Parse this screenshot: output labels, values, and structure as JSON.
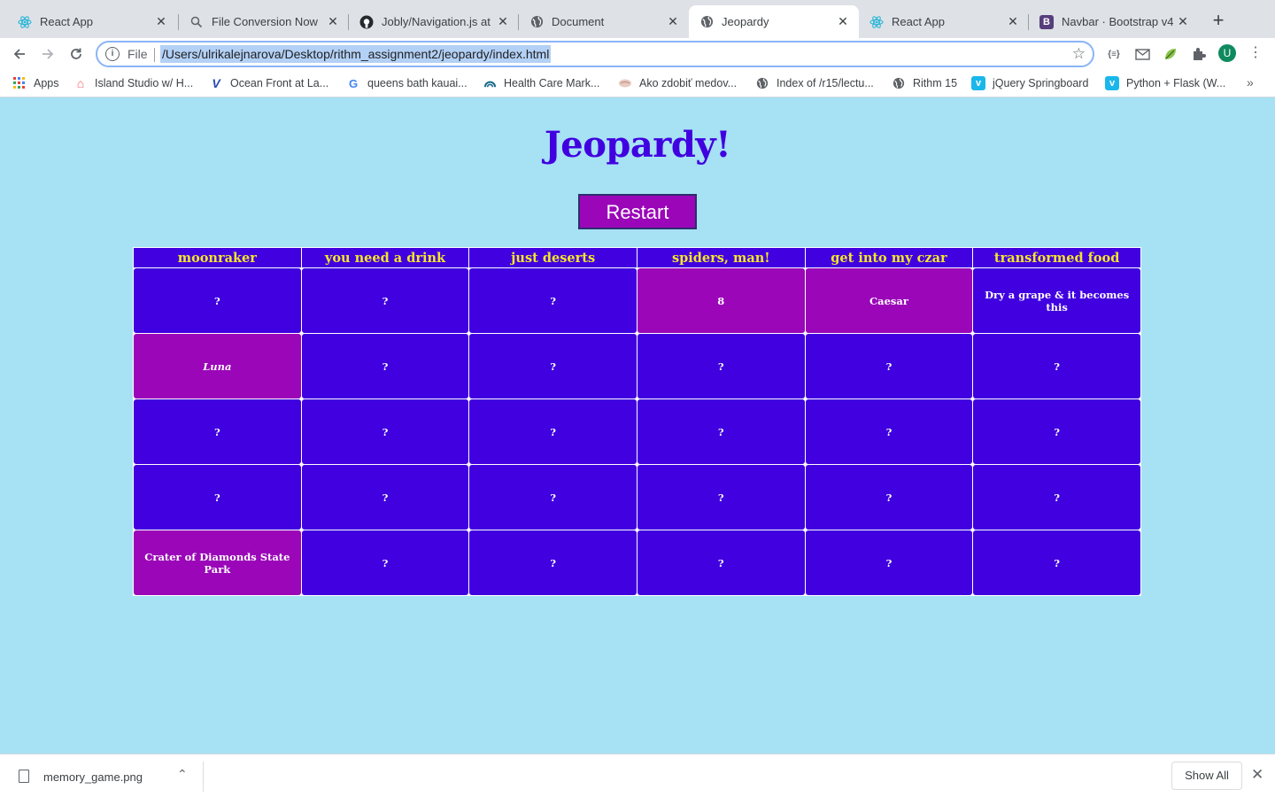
{
  "browser": {
    "tabs": [
      {
        "label": "React App",
        "favicon": "react-icon",
        "active": false
      },
      {
        "label": "File Conversion Now",
        "favicon": "search-icon",
        "active": false
      },
      {
        "label": "Jobly/Navigation.js at",
        "favicon": "github-icon",
        "active": false
      },
      {
        "label": "Document",
        "favicon": "globe-icon",
        "active": false
      },
      {
        "label": "Jeopardy",
        "favicon": "globe-icon",
        "active": true
      },
      {
        "label": "React App",
        "favicon": "react-icon",
        "active": false
      },
      {
        "label": "Navbar · Bootstrap v4",
        "favicon": "bootstrap-icon",
        "active": false
      }
    ],
    "address": {
      "scheme": "File",
      "url": "/Users/ulrikalejnarova/Desktop/rithm_assignment2/jeopardy/index.html"
    },
    "profile_initial": "U",
    "bookmarks": [
      {
        "label": "Apps",
        "icon": "apps-grid-icon"
      },
      {
        "label": "Island Studio w/ H...",
        "icon": "airbnb-icon"
      },
      {
        "label": "Ocean Front at La...",
        "icon": "vrbo-icon"
      },
      {
        "label": "queens bath kauai...",
        "icon": "google-icon"
      },
      {
        "label": "Health Care Mark...",
        "icon": "healthcare-icon"
      },
      {
        "label": "Ako zdobiť medov...",
        "icon": "cookie-icon"
      },
      {
        "label": "Index of /r15/lectu...",
        "icon": "globe-icon"
      },
      {
        "label": "Rithm 15",
        "icon": "globe-icon"
      },
      {
        "label": "jQuery Springboard",
        "icon": "vimeo-icon"
      },
      {
        "label": "Python + Flask (W...",
        "icon": "vimeo-icon"
      }
    ]
  },
  "page": {
    "title": "Jeopardy!",
    "restart_label": "Restart",
    "categories": [
      "moonraker",
      "you need a drink",
      "just deserts",
      "spiders, man!",
      "get into my czar",
      "transformed food"
    ],
    "rows": [
      [
        {
          "text": "?",
          "state": "hidden"
        },
        {
          "text": "?",
          "state": "hidden"
        },
        {
          "text": "?",
          "state": "hidden"
        },
        {
          "text": "8",
          "state": "question"
        },
        {
          "text": "Caesar",
          "state": "question"
        },
        {
          "text": "Dry a grape & it becomes this",
          "state": "question-blue"
        }
      ],
      [
        {
          "text": "Luna",
          "state": "answer"
        },
        {
          "text": "?",
          "state": "hidden"
        },
        {
          "text": "?",
          "state": "hidden"
        },
        {
          "text": "?",
          "state": "hidden"
        },
        {
          "text": "?",
          "state": "hidden"
        },
        {
          "text": "?",
          "state": "hidden"
        }
      ],
      [
        {
          "text": "?",
          "state": "hidden"
        },
        {
          "text": "?",
          "state": "hidden"
        },
        {
          "text": "?",
          "state": "hidden"
        },
        {
          "text": "?",
          "state": "hidden"
        },
        {
          "text": "?",
          "state": "hidden"
        },
        {
          "text": "?",
          "state": "hidden"
        }
      ],
      [
        {
          "text": "?",
          "state": "hidden"
        },
        {
          "text": "?",
          "state": "hidden"
        },
        {
          "text": "?",
          "state": "hidden"
        },
        {
          "text": "?",
          "state": "hidden"
        },
        {
          "text": "?",
          "state": "hidden"
        },
        {
          "text": "?",
          "state": "hidden"
        }
      ],
      [
        {
          "text": "Crater of Diamonds State Park",
          "state": "question"
        },
        {
          "text": "?",
          "state": "hidden"
        },
        {
          "text": "?",
          "state": "hidden"
        },
        {
          "text": "?",
          "state": "hidden"
        },
        {
          "text": "?",
          "state": "hidden"
        },
        {
          "text": "?",
          "state": "hidden"
        }
      ]
    ],
    "colors": {
      "background": "#a6e1f4",
      "cell_hidden": "#4000e0",
      "cell_revealed": "#9a06b8",
      "category_text": "#f5e52a",
      "title": "#4000e0"
    }
  },
  "downloads": {
    "file_name": "memory_game.png",
    "show_all_label": "Show All"
  }
}
